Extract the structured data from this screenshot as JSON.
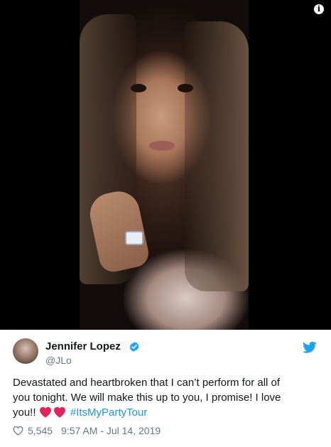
{
  "media": {
    "info_glyph": "i"
  },
  "author": {
    "display_name": "Jennifer Lopez",
    "username": "@JLo",
    "verified": true
  },
  "tweet": {
    "lines": [
      "Devastated and heartbroken that I can’t perform for all of",
      "you tonight. We will make this up to you, I promise! I love"
    ],
    "line3_prefix": "you!!",
    "hashtag": "#ItsMyPartyTour",
    "emoji": [
      "red-heart",
      "red-heart"
    ]
  },
  "footer": {
    "like_count": "5,545",
    "timestamp": "9:57 AM - Jul 14, 2019"
  },
  "colors": {
    "link": "#1b95e0",
    "text": "#14171a",
    "muted": "#657786",
    "heart": "#e0245e",
    "verified": "#1da1f2"
  },
  "icons": [
    "info-icon",
    "verified-badge-icon",
    "twitter-bird-icon",
    "heart-outline-icon",
    "red-heart-emoji"
  ]
}
